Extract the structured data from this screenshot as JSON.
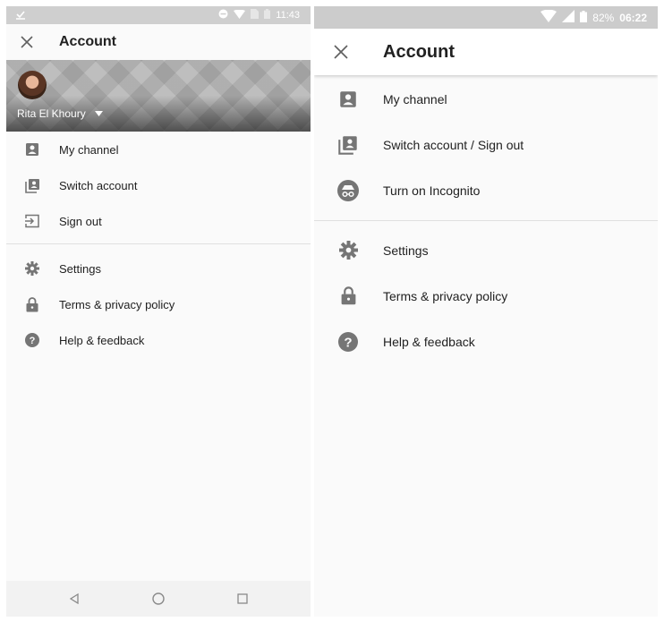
{
  "left_screen": {
    "status": {
      "time": "11:43",
      "icons": [
        "download-done-icon",
        "minus-circle-icon",
        "wifi-icon",
        "sim-off-icon",
        "battery-icon"
      ]
    },
    "header": {
      "close_icon": "close-icon",
      "title": "Account"
    },
    "profile": {
      "name": "Rita El Khoury"
    },
    "menu_primary": [
      {
        "label": "My channel",
        "icon": "person-box-icon"
      },
      {
        "label": "Switch account",
        "icon": "switch-account-icon"
      },
      {
        "label": "Sign out",
        "icon": "sign-out-icon"
      }
    ],
    "menu_secondary": [
      {
        "label": "Settings",
        "icon": "gear-icon"
      },
      {
        "label": "Terms & privacy policy",
        "icon": "lock-icon"
      },
      {
        "label": "Help & feedback",
        "icon": "help-icon"
      }
    ],
    "navbar": [
      "back-icon",
      "home-icon",
      "recents-icon"
    ]
  },
  "right_screen": {
    "status": {
      "battery": "82%",
      "time": "06:22"
    },
    "header": {
      "title": "Account"
    },
    "menu_primary": [
      {
        "label": "My channel",
        "icon": "person-box-icon"
      },
      {
        "label": "Switch account / Sign out",
        "icon": "switch-account-icon"
      },
      {
        "label": "Turn on Incognito",
        "icon": "incognito-icon"
      }
    ],
    "menu_secondary": [
      {
        "label": "Settings",
        "icon": "gear-icon"
      },
      {
        "label": "Terms & privacy policy",
        "icon": "lock-icon"
      },
      {
        "label": "Help & feedback",
        "icon": "help-icon"
      }
    ]
  },
  "colors": {
    "icon_gray": "#757575",
    "status_bar": "#cccccc",
    "divider": "#e0e0e0"
  }
}
